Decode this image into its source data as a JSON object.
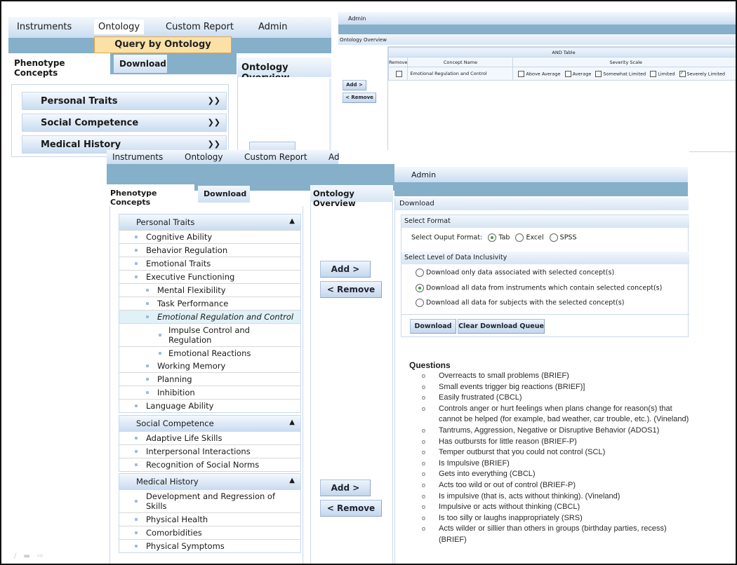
{
  "screen_a": {
    "menu": [
      "Instruments",
      "Ontology",
      "Custom Report",
      "Admin"
    ],
    "active_menu": "Ontology",
    "submenu_item": "Query by Ontology",
    "tabs": [
      "Phenotype Concepts",
      "Download"
    ],
    "overview_tab": "Ontology Overview",
    "accordion": [
      {
        "label": "Personal Traits",
        "icon": "chevron-double-down-icon"
      },
      {
        "label": "Social Competence",
        "icon": "chevron-double-down-icon"
      },
      {
        "label": "Medical History",
        "icon": "chevron-double-down-icon"
      }
    ]
  },
  "screen_b": {
    "menu_label": "Admin",
    "overview_label": "Ontology Overview",
    "add_label": "Add >",
    "remove_label": "< Remove",
    "table": {
      "title": "AND Table",
      "columns": [
        "Remove",
        "Concept Name",
        "Severity Scale"
      ],
      "rows": [
        {
          "remove_checked": false,
          "concept": "Emotional Regulation and Control",
          "severity": [
            {
              "label": "Above Average",
              "checked": false
            },
            {
              "label": "Average",
              "checked": false
            },
            {
              "label": "Somewhat Limited",
              "checked": false
            },
            {
              "label": "Limited",
              "checked": false
            },
            {
              "label": "Severely Limited",
              "checked": true
            }
          ]
        }
      ]
    }
  },
  "screen_c": {
    "menu": [
      "Instruments",
      "Ontology",
      "Custom Report",
      "Ad"
    ],
    "admin_label": "Admin",
    "tabs": [
      "Phenotype Concepts",
      "Download"
    ],
    "overview_tab": "Ontology Overview",
    "add_label": "Add >",
    "remove_label": "< Remove",
    "groups": [
      {
        "label": "Personal Traits",
        "icon": "chevron-double-up-icon",
        "items": [
          {
            "label": "Cognitive Ability",
            "level": 1
          },
          {
            "label": "Behavior Regulation",
            "level": 1
          },
          {
            "label": "Emotional Traits",
            "level": 1
          },
          {
            "label": "Executive Functioning",
            "level": 1
          },
          {
            "label": "Mental Flexibility",
            "level": 2
          },
          {
            "label": "Task Performance",
            "level": 2
          },
          {
            "label": "Emotional Regulation and Control",
            "level": 2,
            "selected": true
          },
          {
            "label": "Impulse Control and Regulation",
            "level": 3
          },
          {
            "label": "Emotional Reactions",
            "level": 3
          },
          {
            "label": "Working Memory",
            "level": 2
          },
          {
            "label": "Planning",
            "level": 2
          },
          {
            "label": "Inhibition",
            "level": 2
          },
          {
            "label": "Language Ability",
            "level": 1
          }
        ]
      },
      {
        "label": "Social Competence",
        "icon": "chevron-double-up-icon",
        "items": [
          {
            "label": "Adaptive Life Skills",
            "level": 1
          },
          {
            "label": "Interpersonal Interactions",
            "level": 1
          },
          {
            "label": "Recognition of Social Norms",
            "level": 1
          }
        ]
      },
      {
        "label": "Medical History",
        "icon": "chevron-double-up-icon",
        "items": [
          {
            "label": "Development and Regression of Skills",
            "level": 1
          },
          {
            "label": "Physical Health",
            "level": 1
          },
          {
            "label": "Comorbidities",
            "level": 1
          },
          {
            "label": "Physical Symptoms",
            "level": 1
          }
        ]
      }
    ],
    "download": {
      "title": "Download",
      "format_section": "Select Format",
      "format_label": "Select Ouput Format:",
      "formats": [
        {
          "label": "Tab",
          "selected": true
        },
        {
          "label": "Excel",
          "selected": false
        },
        {
          "label": "SPSS",
          "selected": false
        }
      ],
      "inclusivity_section": "Select Level of Data Inclusivity",
      "inclusivity_options": [
        {
          "label": "Download only data associated with selected concept(s)",
          "selected": false
        },
        {
          "label": "Download all data from instruments which contain selected concept(s)",
          "selected": true
        },
        {
          "label": "Download all data for subjects with the selected concept(s)",
          "selected": false
        }
      ],
      "download_button": "Download",
      "clear_button": "Clear Download Queue"
    },
    "questions": {
      "title": "Questions",
      "items": [
        "Overreacts to small problems (BRIEF)",
        "Small events trigger big reactions (BRIEF)]",
        "Easily frustrated (CBCL)",
        "Controls anger or hurt feelings when plans change for reason(s) that cannot be helped (for example, bad weather, car trouble, etc.). (Vineland)",
        "Tantrums, Aggression, Negative or Disruptive Behavior (ADOS1)",
        "Has outbursts for little reason (BRIEF-P)",
        "Temper outburst that you could not control (SCL)",
        "Is Impulsive (BRIEF)",
        "Gets into everything (CBCL)",
        "Acts too wild or out of control (BRIEF-P)",
        "Is impulsive (that is, acts without thinking). (Vineland)",
        "Impulsive or acts without thinking (CBCL)",
        "Is too silly or laughs inappropriately (SRS)",
        "Acts wilder or sillier than others in groups (birthday parties, recess) (BRIEF)"
      ]
    }
  },
  "colors": {
    "band": "#86afc9",
    "menu_gradient_top": "#f4f8fd",
    "menu_gradient_bottom": "#c9dcf1",
    "submenu_highlight": "#fbe1a6",
    "selected_row": "#e1f1f8",
    "radio_selected": "#35a035"
  }
}
